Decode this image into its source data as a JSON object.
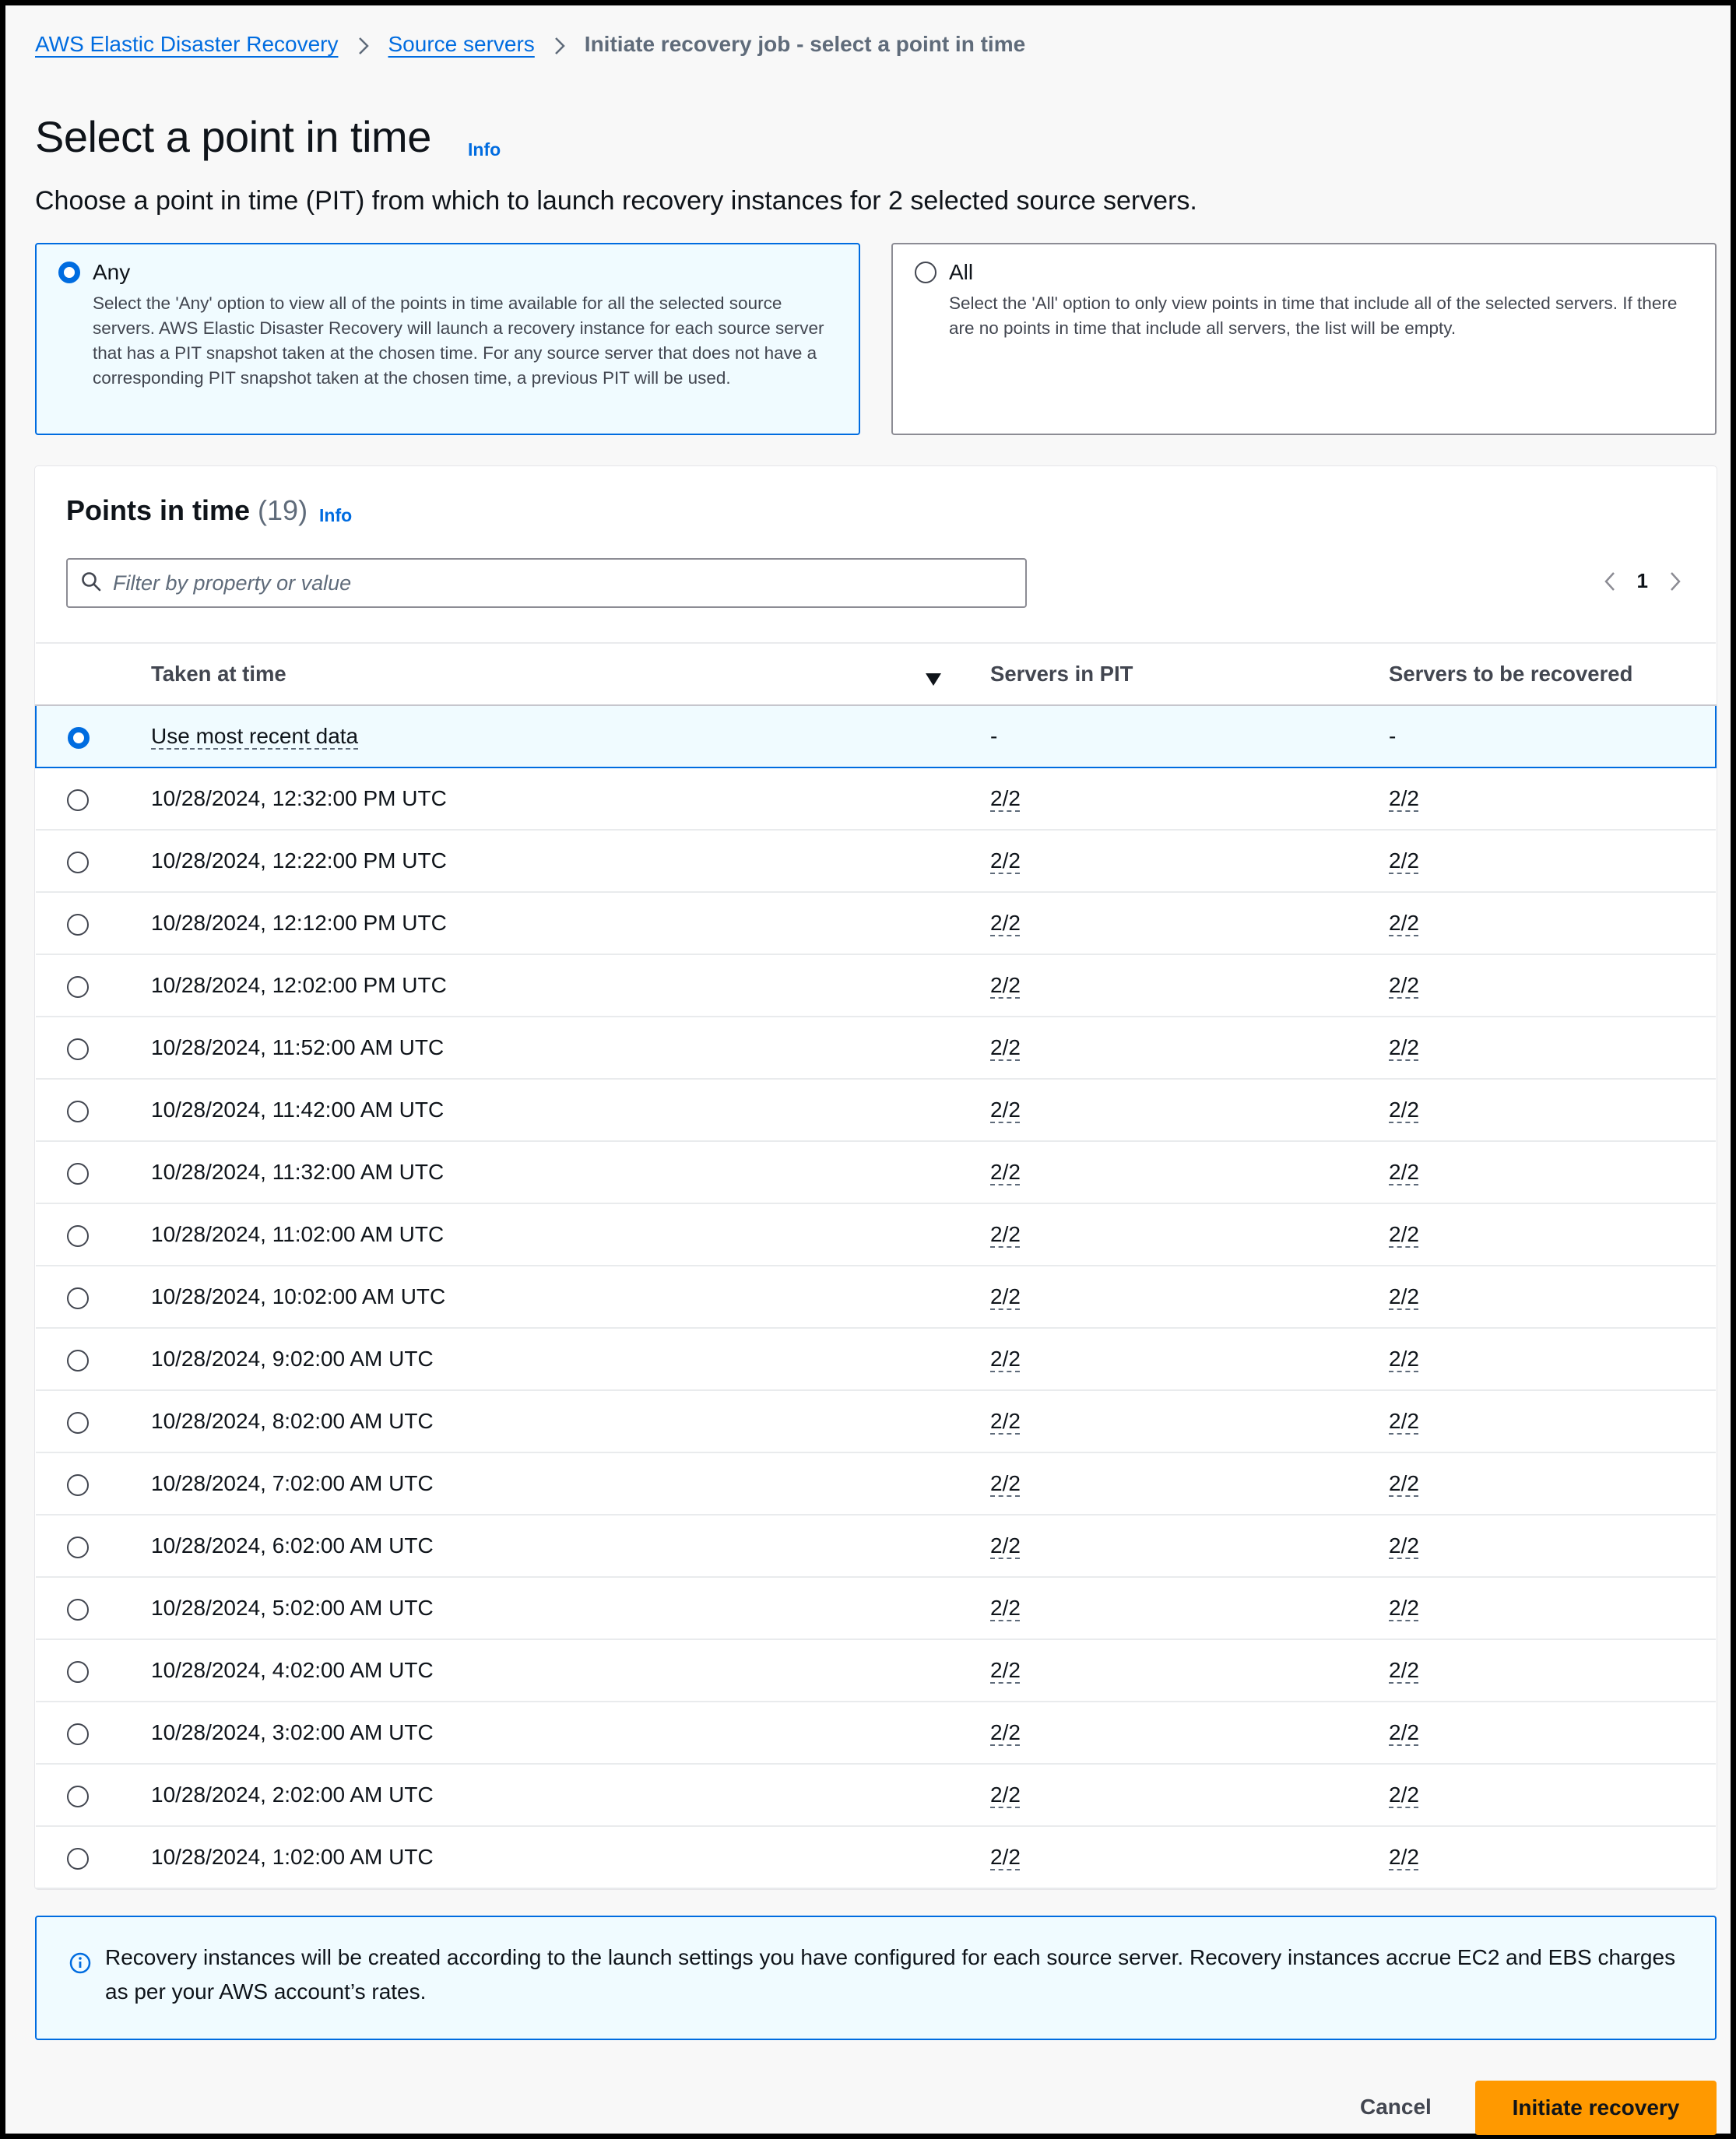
{
  "breadcrumb": {
    "items": [
      "AWS Elastic Disaster Recovery",
      "Source servers"
    ],
    "current": "Initiate recovery job - select a point in time"
  },
  "header": {
    "title": "Select a point in time",
    "info": "Info",
    "description": "Choose a point in time (PIT) from which to launch recovery instances for 2 selected source servers."
  },
  "options": {
    "any": {
      "label": "Any",
      "selected": true,
      "description": "Select the 'Any' option to view all of the points in time available for all the selected source servers. AWS Elastic Disaster Recovery will launch a recovery instance for each source server that has a PIT snapshot taken at the chosen time. For any source server that does not have a corresponding PIT snapshot taken at the chosen time, a previous PIT will be used."
    },
    "all": {
      "label": "All",
      "selected": false,
      "description": "Select the 'All' option to only view points in time that include all of the selected servers. If there are no points in time that include all servers, the list will be empty."
    }
  },
  "table": {
    "title": "Points in time",
    "count": "(19)",
    "info": "Info",
    "filter_placeholder": "Filter by property or value",
    "page": "1",
    "columns": [
      "Taken at time",
      "Servers in PIT",
      "Servers to be recovered"
    ],
    "rows": [
      {
        "time": "Use most recent data",
        "pit": "-",
        "rec": "-",
        "selected": true
      },
      {
        "time": "10/28/2024, 12:32:00 PM UTC",
        "pit": "2/2",
        "rec": "2/2"
      },
      {
        "time": "10/28/2024, 12:22:00 PM UTC",
        "pit": "2/2",
        "rec": "2/2"
      },
      {
        "time": "10/28/2024, 12:12:00 PM UTC",
        "pit": "2/2",
        "rec": "2/2"
      },
      {
        "time": "10/28/2024, 12:02:00 PM UTC",
        "pit": "2/2",
        "rec": "2/2"
      },
      {
        "time": "10/28/2024, 11:52:00 AM UTC",
        "pit": "2/2",
        "rec": "2/2"
      },
      {
        "time": "10/28/2024, 11:42:00 AM UTC",
        "pit": "2/2",
        "rec": "2/2"
      },
      {
        "time": "10/28/2024, 11:32:00 AM UTC",
        "pit": "2/2",
        "rec": "2/2"
      },
      {
        "time": "10/28/2024, 11:02:00 AM UTC",
        "pit": "2/2",
        "rec": "2/2"
      },
      {
        "time": "10/28/2024, 10:02:00 AM UTC",
        "pit": "2/2",
        "rec": "2/2"
      },
      {
        "time": "10/28/2024, 9:02:00 AM UTC",
        "pit": "2/2",
        "rec": "2/2"
      },
      {
        "time": "10/28/2024, 8:02:00 AM UTC",
        "pit": "2/2",
        "rec": "2/2"
      },
      {
        "time": "10/28/2024, 7:02:00 AM UTC",
        "pit": "2/2",
        "rec": "2/2"
      },
      {
        "time": "10/28/2024, 6:02:00 AM UTC",
        "pit": "2/2",
        "rec": "2/2"
      },
      {
        "time": "10/28/2024, 5:02:00 AM UTC",
        "pit": "2/2",
        "rec": "2/2"
      },
      {
        "time": "10/28/2024, 4:02:00 AM UTC",
        "pit": "2/2",
        "rec": "2/2"
      },
      {
        "time": "10/28/2024, 3:02:00 AM UTC",
        "pit": "2/2",
        "rec": "2/2"
      },
      {
        "time": "10/28/2024, 2:02:00 AM UTC",
        "pit": "2/2",
        "rec": "2/2"
      },
      {
        "time": "10/28/2024, 1:02:00 AM UTC",
        "pit": "2/2",
        "rec": "2/2"
      }
    ]
  },
  "alert": {
    "text": "Recovery instances will be created according to the launch settings you have configured for each source server. Recovery instances accrue EC2 and EBS charges as per your AWS account’s rates."
  },
  "footer": {
    "cancel": "Cancel",
    "primary": "Initiate recovery"
  },
  "colors": {
    "link": "#006ce0",
    "primary_button": "#ff9900",
    "selected_bg": "#f0fbff"
  }
}
